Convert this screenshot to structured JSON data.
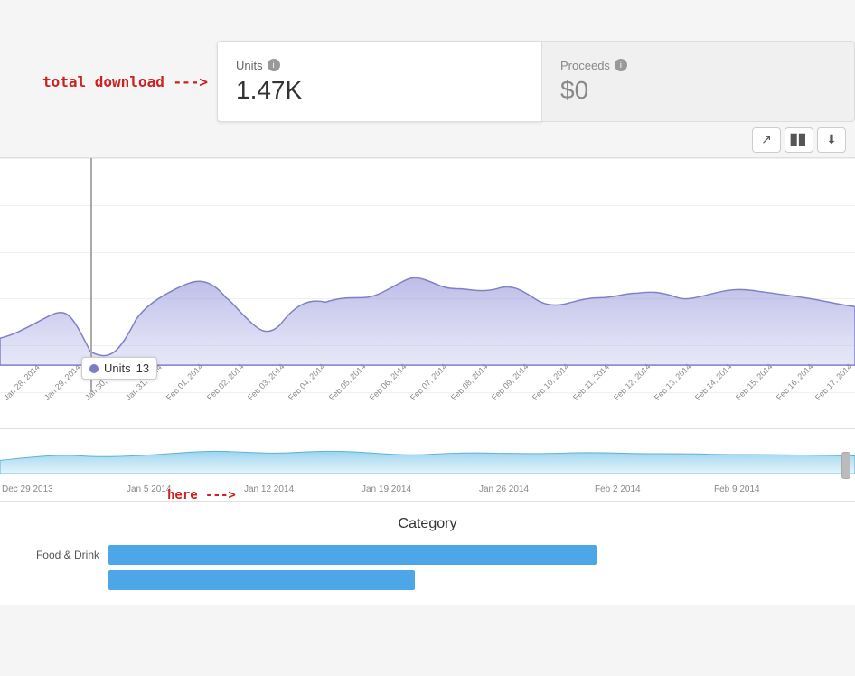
{
  "header": {
    "total_download_label": "total download --->",
    "units_label": "Units",
    "units_value": "1.47K",
    "proceeds_label": "Proceeds",
    "proceeds_value": "$0"
  },
  "toolbar": {
    "line_chart_icon": "↗",
    "bar_chart_icon": "▋▋",
    "download_icon": "⬇"
  },
  "chart": {
    "tooltip": {
      "label": "Units",
      "value": "13"
    },
    "x_labels": [
      "Jan 28, 2014",
      "Jan 29, 2014",
      "Jan 30, 2014",
      "Jan 31, 2014",
      "Feb 01, 2014",
      "Feb 02, 2014",
      "Feb 03, 2014",
      "Feb 04, 2014",
      "Feb 05, 2014",
      "Feb 06, 2014",
      "Feb 07, 2014",
      "Feb 08, 2014",
      "Feb 09, 2014",
      "Feb 10, 2014",
      "Feb 11, 2014",
      "Feb 12, 2014",
      "Feb 13, 2014",
      "Feb 14, 2014",
      "Feb 15, 2014",
      "Feb 16, 2014",
      "Feb 17, 2014"
    ]
  },
  "mini_chart": {
    "x_labels": [
      "Dec 29 2013",
      "Jan 5 2014",
      "Jan 12 2014",
      "Jan 19 2014",
      "Jan 26 2014",
      "Feb 2 2014",
      "Feb 9 2014"
    ]
  },
  "here_label": "here --->",
  "category": {
    "title": "Category",
    "items": [
      {
        "label": "Food & Drink",
        "width_pct": 67
      }
    ]
  }
}
